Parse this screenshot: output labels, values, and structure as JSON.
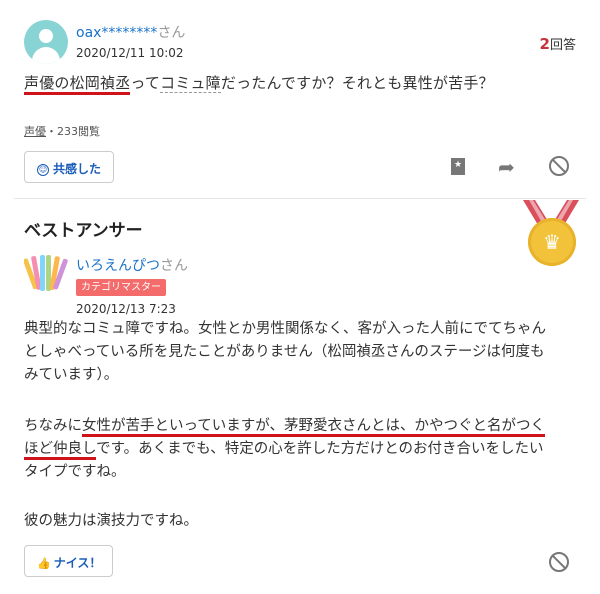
{
  "question": {
    "user": "oax********",
    "user_suffix": "さん",
    "date": "2020/12/11 10:02",
    "answer_count": "2",
    "answer_label": "回答",
    "text_part1": "声優の松岡禎丞",
    "text_part2": "って",
    "text_part3": "コミュ障",
    "text_part4": "だったんですか？それとも異性が苦手？",
    "category": "声優",
    "views": "・233閲覧",
    "empathy_label": "共感した"
  },
  "best_answer": {
    "section_title": "ベストアンサー",
    "user": "いろえんぴつ",
    "user_suffix": "さん",
    "badge": "カテゴリマスター",
    "date": "2020/12/13 7:23",
    "p1_line1": "典型的なコミュ障ですね。女性とか男性関係なく、客が入った人前にでてちゃん",
    "p1_line2": "としゃべっている所を見たことがありません（松岡禎丞さんのステージは何度も",
    "p1_line3": "みています）。",
    "p2_line1_a": "ちなみに",
    "p2_line1_b": "女性が苦手といっていますが、茅野愛衣さんとは、かやつぐと名がつく",
    "p2_line2_a": "ほど仲良し",
    "p2_line2_b": "です。あくまでも、特定の心を許した方だけとのお付き合いをしたい",
    "p2_line3": "タイプですね。",
    "p3": "彼の魅力は演技力ですね。",
    "nice_label": "ナイス！"
  },
  "colors": {
    "accent_blue": "#1a73c7",
    "highlight_red": "#d0121b",
    "medal_gold": "#f2c23b",
    "badge_pink": "#f36b6b"
  },
  "icons": [
    "user-avatar-icon",
    "bookmark-icon",
    "share-icon",
    "block-icon",
    "medal-icon",
    "thumbs-up-icon",
    "smiley-icon"
  ]
}
